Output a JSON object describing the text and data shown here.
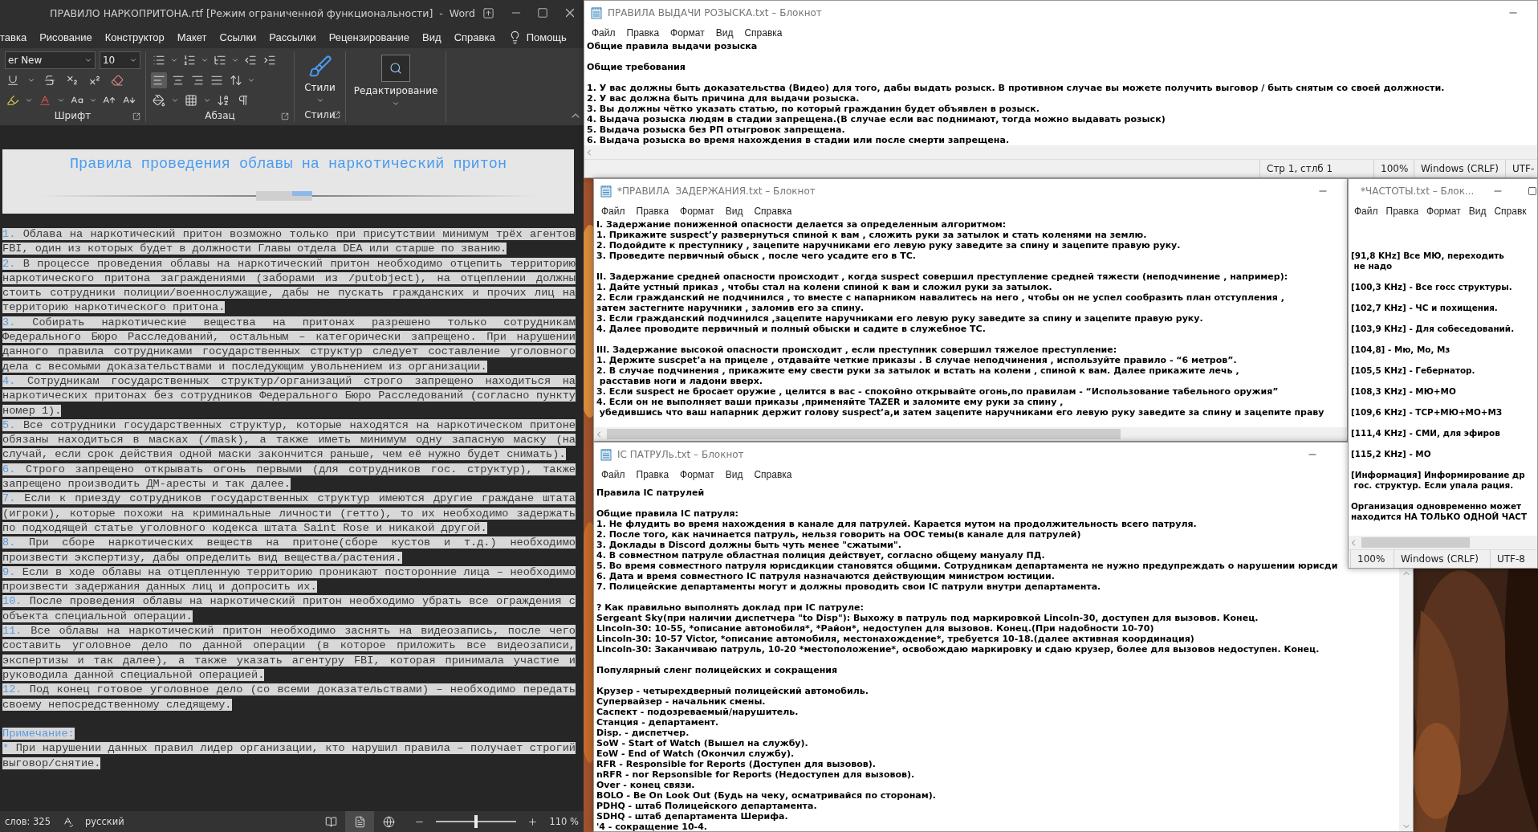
{
  "word": {
    "title": "ПРАВИЛО НАРКОПРИТОНА.rtf [Режим ограниченной функциональности]  -  Word",
    "tabs": [
      "тавка",
      "Рисование",
      "Конструктор",
      "Макет",
      "Ссылки",
      "Рассылки",
      "Рецензирование",
      "Вид",
      "Справка"
    ],
    "help": "Помощь",
    "font_name": "er New",
    "font_size": "10",
    "alignment": [
      {
        "kind": "left",
        "selected": true
      },
      {
        "kind": "center",
        "selected": false
      },
      {
        "kind": "right",
        "selected": false
      },
      {
        "kind": "justify",
        "selected": false
      }
    ],
    "group_labels": [
      "Шрифт",
      "Абзац",
      "Стили"
    ],
    "styles_button": "Стили",
    "editing_button": "Редактирование",
    "document": {
      "heading": "Правила проведения облавы на наркотический притон",
      "items": [
        {
          "number": "1.",
          "text": "Облава на наркотический притон возможно только при присутствии минимум трёх агентов FBI, один из которых будет в должности Главы отдела DEA или старше по званию."
        },
        {
          "number": "2.",
          "text": "В процессе проведения облавы на наркотический притон необходимо отцепить территорию наркотического притона заграждениями (заборами из /putobject), на отцеплении должны стоить сотрудники полиции/военнослужащие, дабы не пускать гражданских и прочих лиц на территорию наркотического притона."
        },
        {
          "number": "3.",
          "text": "Собирать наркотические вещества на притонах разрешено только сотрудникам Федерального Бюро Расследований, остальным – категорически запрещено. При нарушении данного правила сотрудниками государственных структур следует составление уголовного дела с весомыми доказательствами и последующим увольнением из организации."
        },
        {
          "number": "4.",
          "text": "Сотрудникам государственных структур/организаций строго запрещено находиться на наркотических притонах без сотрудников Федерального Бюро Расследований (согласно пункту номер 1)."
        },
        {
          "number": "5.",
          "text": "Все сотрудники государственных структур, которые находятся на наркотическом притоне обязаны находиться в масках (/mask), а также иметь минимум одну запасную маску (на случай, если срок действия одной маски закончится раньше, чем её нужно будет снимать)."
        },
        {
          "number": "6.",
          "text": "Строго запрещено открывать огонь первыми (для сотрудников гос. структур), также запрещено производить ДМ-аресты и так далее."
        },
        {
          "number": "7.",
          "text": "Если к приезду сотрудников государственных структур имеются другие граждане штата (игроки), которые похожи на криминальные личности (гетто), то их необходимо задержать по подходящей статье уголовного кодекса штата Saint Rose и никакой другой."
        },
        {
          "number": "8.",
          "text": "При сборе наркотических веществ на притоне(сборе кустов и т.д.) необходимо произвести экспертизу, дабы определить вид вещества/растения."
        },
        {
          "number": "9.",
          "text": "Если в ходе облавы на отцепленную территорию проникают посторонние лица – необходимо произвести задержания данных лиц и допросить их."
        },
        {
          "number": "10.",
          "text": "После проведения облавы на наркотический притон необходимо убрать все ограждения с объекта специальной операции."
        },
        {
          "number": "11.",
          "text": "Все облавы на наркотический притон необходимо заснять на видеозапись, после чего составить уголовное дело по данной операции (в которое приложить все видеозаписи, экспертизы и так далее), а также указать агентуру FBI, которая принимала участие и руководила данной специальной операцией."
        },
        {
          "number": "12.",
          "text": "Под конец готовое уголовное дело (со всеми доказательствами) – необходимо передать своему непосредственному следящему."
        }
      ],
      "note_label": "Примечание:",
      "note_marker": "*",
      "note": "При нарушении данных правил лидер организации, кто нарушил правила – получает строгий выговор/снятие."
    },
    "status": {
      "words": "слов: 325",
      "language": "русский",
      "views": [
        {
          "kind": "read",
          "selected": false
        },
        {
          "kind": "print",
          "selected": true
        },
        {
          "kind": "web",
          "selected": false
        }
      ],
      "zoom_slider": {
        "level": 0.5
      },
      "zoom": "110 %"
    }
  },
  "notepads": [
    {
      "title": "ПРАВИЛА ВЫДАЧИ РОЗЫСКА.txt – Блокнот",
      "menu": [
        "Файл",
        "Правка",
        "Формат",
        "Вид",
        "Справка"
      ],
      "blocks": [
        [
          "Общие правила выдачи розыска"
        ],
        [
          "Общие требования"
        ],
        [
          "1. У вас должны быть доказательства (Видео) для того, дабы выдать розыск. В противном случае вы можете получить выговор / быть снятым со своей должности.",
          "2. У вас должна быть причина для выдачи розыска.",
          "3. Вы должны чётко указать статью, по который гражданин будет объявлен в розыск.",
          "4. Выдача розыска людям в стадии запрещена.(В случае если вас поднимают, тогда можно выдавать розыск)",
          "5. Выдача розыска без РП отыгровок запрещена.",
          "6. Выдача розыска во время нахождения в стадии или после смерти запрещена."
        ]
      ],
      "status": [
        "Стр 1, стлб 1",
        "100%",
        "Windows (CRLF)",
        "UTF-"
      ]
    },
    {
      "title": "*ПРАВИЛА  ЗАДЕРЖАНИЯ.txt – Блокнот",
      "menu": [
        "Файл",
        "Правка",
        "Формат",
        "Вид",
        "Справка"
      ],
      "blocks": [
        [
          "I. Задержание пониженной опасности делается за определенным алгоритмом:",
          "1. Прикажите suspect’у развернуться спиной к вам , сложить руки за затылок и стать коленями на землю.",
          "2. Подойдите к преступнику , зацепите наручниками его левую руку заведите за спину и зацепите правую руку.",
          "3. Проведите первичный обыск , после чего усадите его в ТС."
        ],
        [
          "II. Задержание средней опасности происходит , когда suspect совершил преступление средней тяжести (неподчинение , например):",
          "1. Дайте устный приказ , чтобы стал на колени спиной к вам и сложил руки за затылок.",
          "2. Если гражданский не подчинился , то вместе с напарником навалитесь на него , чтобы он не успел сообразить план отступления ,",
          "затем застегните наручники , заломив его за спину.",
          "3. Если гражданский подчинился ,зацепите наручниками его левую руку заведите за спину и зацепите правую руку.",
          "4. Далее проводите первичный и полный обыски и садите в служебное ТС."
        ],
        [
          "III. Задержание высокой опасности происходит , если преступник совершил тяжелое преступление:",
          "1. Держите suscpet’a на прицеле , отдавайте четкие приказы . В случае неподчинения , используйте правило - “6 метров”.",
          "2. В случае подчинения , прикажите ему свести руки за затылок и встать на колени , спиной к вам. Далее прикажите лечь ,",
          " расставив ноги и ладони вверх.",
          "3. Если suspect не бросает оружие , целится в вас - спокойно открывайте огонь,по правилам - “Использование табельного оружия”",
          "4. Если он не выполняет ваши приказы ,применяйте TAZER и заломите ему руки за спину ,",
          " убедившись что ваш напарник держит голову suspect’a,и затем зацепите наручниками его левую руку заведите за спину и зацепите праву"
        ]
      ]
    },
    {
      "title": "*ЧАСТОТЫ.txt – Блок...",
      "menu": [
        "Файл",
        "Правка",
        "Формат",
        "Вид",
        "Справк"
      ],
      "blocks": [
        [
          "[91,8 KHz] Все МЮ, переходить",
          " не надо"
        ],
        [
          "[100,3 KHz] - Все госс структуры."
        ],
        [
          "[102,7 KHz] - ЧС и похищения."
        ],
        [
          "[103,9 KHz] - Для собеседований."
        ],
        [
          "[104,8] - Мю, Мо, Мз"
        ],
        [
          "[105,5 KHz] - Гебернатор."
        ],
        [
          "[108,3 KHz] - МЮ+МО"
        ],
        [
          "[109,6 KHz] - ТСР+МЮ+МО+МЗ"
        ],
        [
          "[111,4 KHz] - СМИ, для эфиров"
        ],
        [
          "[115,2 KHz] - МО"
        ],
        [
          "[Информация] Информирование др",
          " гос. структур. Если упала рация."
        ],
        [
          "Организация одновременно может",
          "находится НА ТОЛЬКО ОДНОЙ ЧАСТ"
        ]
      ],
      "status": [
        "100%",
        "Windows (CRLF)",
        "UTF-8"
      ]
    },
    {
      "title": "IC ПАТРУЛь.txt – Блокнот",
      "menu": [
        "Файл",
        "Правка",
        "Формат",
        "Вид",
        "Справка"
      ],
      "blocks": [
        [
          "Правила IC патрулей"
        ],
        [
          "Общие правила IC патруля:",
          "1. Не флудить во время нахождения в канале для патрулей. Карается мутом на продолжительность всего патруля.",
          "2. После того, как начинается патруль, нельзя говорить на ООС темы(в канале для патрулей)",
          "3. Доклады в Discord должны быть чуть менее \"сжатыми\".",
          "4. В совместном патруле областная полиция действует, согласно общему мануалу ПД.",
          "5. Во время совместного патруля юрисдикции становятся общими. Сотрудникам департамента не нужно предупреждать о нарушении юрисди",
          "6. Дата и время совместного IC патруля назначаются действующим министром юстиции.",
          "7. Полицейские департаменты могут и должны проводить свои IC патрули внутри департамента."
        ],
        [
          "? Как правильно выполнять доклад при IC патруле:",
          "Sergeant Sky(при наличии диспетчера \"to Disp\"): Выхожу в патруль под маркировкой Lincoln-30, доступен для вызовов. Конец.",
          "Lincoln-30: 10-55, *описание автомобиля*, *Район*, недоступен для вызовов. Конец.(При надобности 10-70)",
          "Lincoln-30: 10-57 Victor, *описание автомобиля, местонахождение*, требуется 10-18.(далее активная координация)",
          "Lincoln-30: Заканчиваю патруль, 10-20 *местоположение*, освобождаю маркировку и сдаю крузер, более для вызовов недоступен. Конец."
        ],
        [
          "Популярный сленг полицейских и сокращения"
        ],
        [
          "Крузер - четырехдверный полицейский автомобиль.",
          "Супервайзер - начальник смены.",
          "Саспект - подозреваемый/нарушитель.",
          "Станция - департамент.",
          "Disp. - диспетчер.",
          "SoW - Start of Watch (Вышел на службу).",
          "EoW - End of Watch (Окончил службу).",
          "RFR - Responsible for Reports (Доступен для вызовов).",
          "nRFR - nor Repsonsible for Reports (Недоступен для вызовов).",
          "Over - конец связи.",
          "BOLO - Be On Look Out (Будь на чеку, осматривайся по сторонам).",
          "PDHQ - штаб Полицейского департамента.",
          "SDHQ - штаб департамента Шерифа.",
          "'4 - сокращение 10-4."
        ]
      ]
    }
  ]
}
